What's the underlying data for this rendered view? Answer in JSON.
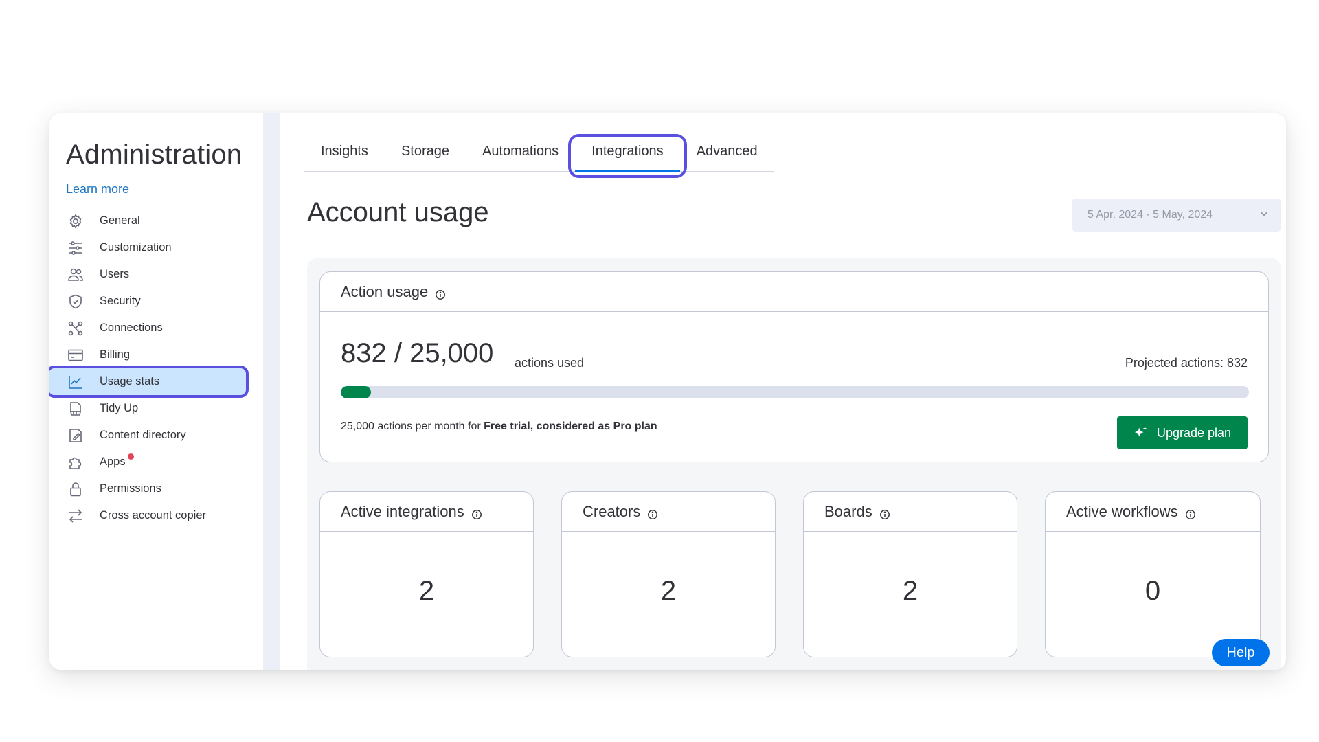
{
  "sidebar": {
    "title": "Administration",
    "learn_more": "Learn more",
    "items": [
      {
        "label": "General",
        "icon": "gear-icon"
      },
      {
        "label": "Customization",
        "icon": "sliders-icon"
      },
      {
        "label": "Users",
        "icon": "users-icon"
      },
      {
        "label": "Security",
        "icon": "shield-icon"
      },
      {
        "label": "Connections",
        "icon": "connections-icon"
      },
      {
        "label": "Billing",
        "icon": "credit-card-icon"
      },
      {
        "label": "Usage stats",
        "icon": "line-chart-icon",
        "active": true
      },
      {
        "label": "Tidy Up",
        "icon": "broom-icon"
      },
      {
        "label": "Content directory",
        "icon": "content-directory-icon"
      },
      {
        "label": "Apps",
        "icon": "puzzle-icon",
        "badge": "red-dot"
      },
      {
        "label": "Permissions",
        "icon": "lock-icon"
      },
      {
        "label": "Cross account copier",
        "icon": "swap-arrows-icon"
      }
    ]
  },
  "tabs": [
    {
      "label": "Insights"
    },
    {
      "label": "Storage"
    },
    {
      "label": "Automations"
    },
    {
      "label": "Integrations",
      "active": true
    },
    {
      "label": "Advanced"
    }
  ],
  "main": {
    "title": "Account usage",
    "date_range": "5 Apr, 2024 - 5 May, 2024"
  },
  "action_usage": {
    "title": "Action usage",
    "used_display": "832 / 25,000",
    "unit": "actions used",
    "projected": "Projected actions: 832",
    "progress_fraction": 0.0333,
    "plan_prefix": "25,000 actions per month for ",
    "plan_bold": "Free trial, considered as Pro plan",
    "upgrade_label": "Upgrade plan"
  },
  "stats": [
    {
      "title": "Active integrations",
      "value": "2"
    },
    {
      "title": "Creators",
      "value": "2"
    },
    {
      "title": "Boards",
      "value": "2"
    },
    {
      "title": "Active workflows",
      "value": "0"
    }
  ],
  "help_label": "Help",
  "colors": {
    "accent": "#0073ea",
    "highlight_outline": "#5b4fe0",
    "progress": "#00854d",
    "upgrade_button": "#00854d",
    "active_nav_bg": "#cce5ff"
  }
}
